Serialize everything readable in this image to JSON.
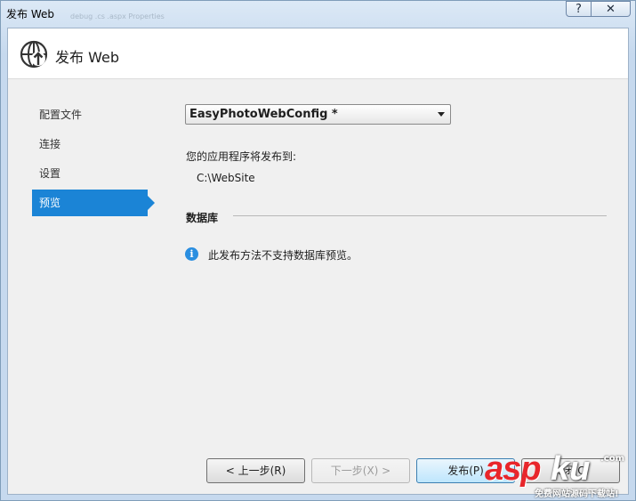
{
  "window": {
    "title": "发布 Web",
    "ghost_text": "debug  .cs  .aspx  Properties"
  },
  "titlebar": {
    "help_label": "?",
    "close_label": "✕"
  },
  "header": {
    "title": "发布 Web",
    "icon": "globe-publish-icon"
  },
  "nav": {
    "items": [
      {
        "label": "配置文件",
        "active": false
      },
      {
        "label": "连接",
        "active": false
      },
      {
        "label": "设置",
        "active": false
      },
      {
        "label": "预览",
        "active": true
      }
    ]
  },
  "main": {
    "profile_value": "EasyPhotoWebConfig *",
    "publish_to_label": "您的应用程序将发布到:",
    "publish_path": "C:\\WebSite",
    "database_section": "数据库",
    "info_icon": "info-icon",
    "info_message": "此发布方法不支持数据库预览。"
  },
  "buttons": {
    "prev": "< 上一步(R)",
    "next": "下一步(X) >",
    "publish": "发布(P)",
    "close": "关闭(C)"
  },
  "watermark": {
    "brand": "asp",
    "brand2": "ku",
    "domain": ".com",
    "sub": "免费网站源码下载站!"
  },
  "colors": {
    "accent": "#1b84d6",
    "info": "#2a8ee0",
    "watermark_red": "#e8262b"
  }
}
